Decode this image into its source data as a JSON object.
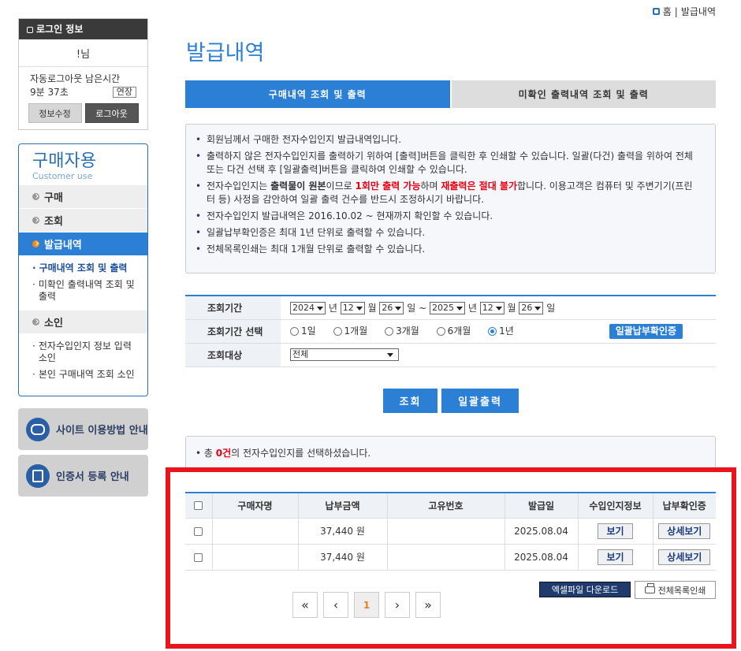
{
  "breadcrumb": {
    "home": "홈",
    "separator": "|",
    "current": "발급내역"
  },
  "login": {
    "title": "로그인 정보",
    "user": "!님",
    "auto_logout_label": "자동로그아웃 남은시간",
    "remaining": "9분 37초",
    "extend": "연장",
    "edit_info": "정보수정",
    "logout": "로그아웃"
  },
  "sidebar": {
    "title": "구매자용",
    "subtitle": "Customer use",
    "menu_purchase": "구매",
    "menu_inquiry": "조회",
    "menu_history": "발급내역",
    "sub_history_1": "구매내역 조회 및 출력",
    "sub_history_2": "미확인 출력내역 조회 및 출력",
    "menu_refund": "소인",
    "sub_refund_1": "전자수입인지 정보 입력 소인",
    "sub_refund_2": "본인 구매내역 조회 소인"
  },
  "promos": {
    "site_guide": "사이트 이용방법 안내",
    "cert_guide": "인증서 등록 안내"
  },
  "page": {
    "title": "발급내역",
    "tab_active": "구매내역 조회 및 출력",
    "tab_inactive": "미확인 출력내역 조회 및 출력"
  },
  "notice": {
    "n1": "회원님께서 구매한 전자수입인지 발급내역입니다.",
    "n2": "출력하지 않은 전자수입인지를 출력하기 위하여 [출력]버튼을 클릭한 후 인쇄할 수 있습니다. 일괄(다건) 출력을 위하여 전체 또는 다건 선택 후 [일괄출력]버튼을 클릭하여 인쇄할 수 있습니다.",
    "n3_a": "전자수입인지는 ",
    "n3_b": "출력물이 원본",
    "n3_c": "이므로 ",
    "n3_d": "1회만 출력 가능",
    "n3_e": "하며 ",
    "n3_f": "재출력은 절대 불가",
    "n3_g": "합니다. 이용고객은 컴퓨터 및 주변기기(프린터 등) 사정을 감안하여 일괄 출력 건수를 반드시 조정하시기 바랍니다.",
    "n4": "전자수입인지 발급내역은 2016.10.02 ~ 현재까지 확인할 수 있습니다.",
    "n5": "일괄납부확인증은 최대 1년 단위로 출력할 수 있습니다.",
    "n6": "전체목록인쇄는 최대 1개월 단위로 출력할 수 있습니다."
  },
  "search": {
    "period_label": "조회기간",
    "from_year": "2024",
    "from_month": "12",
    "from_day": "26",
    "to_year": "2025",
    "to_month": "12",
    "to_day": "26",
    "unit_year": "년",
    "unit_month": "월",
    "unit_day": "일",
    "tilde": "~",
    "range_label": "조회기간 선택",
    "r1": "1일",
    "r2": "1개월",
    "r3": "3개월",
    "r4": "6개월",
    "r5": "1년",
    "bulk_cert": "일괄납부확인증",
    "target_label": "조회대상",
    "target_value": "전체"
  },
  "actions": {
    "search": "조회",
    "bulk_print": "일괄출력"
  },
  "summary": {
    "prefix": "총 ",
    "count": "0건",
    "suffix": "의 전자수입인지를 선택하셨습니다."
  },
  "table": {
    "headers": [
      "구매자명",
      "납부금액",
      "고유번호",
      "발급일",
      "수입인지정보",
      "납부확인증"
    ],
    "rows": [
      {
        "buyer": "",
        "amount": "37,440 원",
        "id": "",
        "date": "2025.08.04",
        "info": "보기",
        "cert": "상세보기"
      },
      {
        "buyer": "",
        "amount": "37,440 원",
        "id": "",
        "date": "2025.08.04",
        "info": "보기",
        "cert": "상세보기"
      }
    ]
  },
  "footer": {
    "excel": "엑셀파일 다운로드",
    "print_all": "전체목록인쇄"
  },
  "pager": {
    "first": "«",
    "prev": "‹",
    "current": "1",
    "next": "›",
    "last": "»"
  },
  "colors": {
    "primary": "#2b7fd4",
    "highlight": "#e8161c",
    "emphasis": "#e60012"
  }
}
